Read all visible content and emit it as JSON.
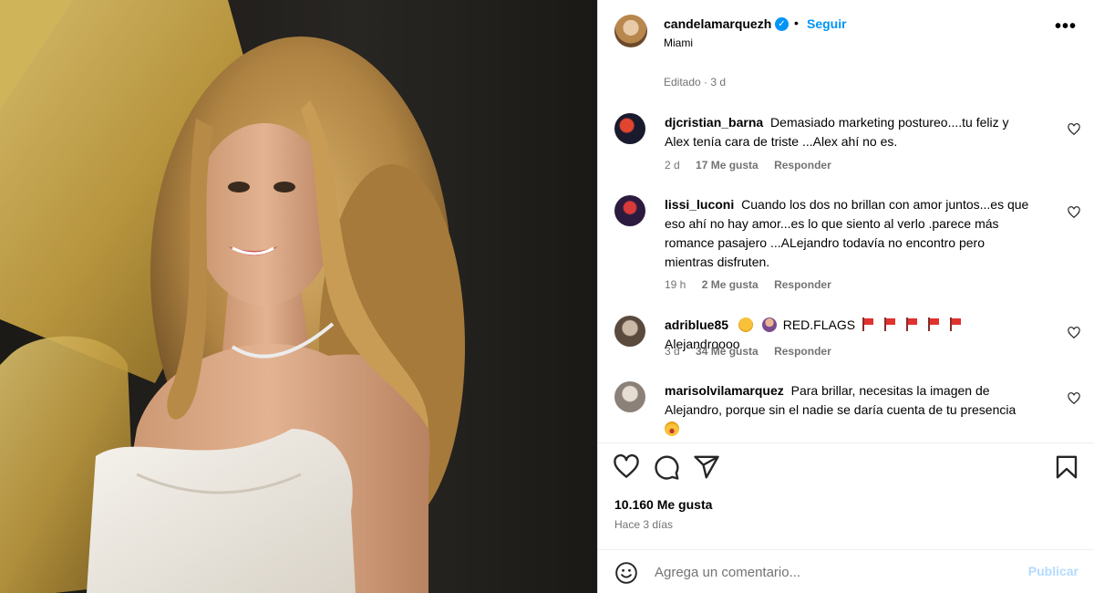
{
  "post": {
    "owner": "candelamarquezh",
    "verified_mark": "✓",
    "separator": "•",
    "follow_label": "Seguir",
    "location": "Miami",
    "more_label": "•••",
    "edited": "Editado · 3 d"
  },
  "comments": [
    {
      "user": "djcristian_barna",
      "text": "Demasiado marketing postureo....tu feliz y Alex tenía cara de triste ...Alex ahí no es.",
      "time": "2 d",
      "likes": "17 Me gusta",
      "reply": "Responder"
    },
    {
      "user": "lissi_luconi",
      "text": "Cuando los dos no brillan con amor juntos...es que eso ahí no hay amor...es lo que siento al verlo .parece más romance pasajero ...ALejandro todavía no encontro pero mientras disfruten.",
      "time": "19 h",
      "likes": "2 Me gusta",
      "reply": "Responder"
    },
    {
      "user": "adriblue85",
      "text_a": "RED.FLAGS",
      "text_b": "Alejandroooo",
      "time": "3 d",
      "likes": "34 Me gusta",
      "reply": "Responder"
    },
    {
      "user": "marisolvilamarquez",
      "text": "Para brillar, necesitas la imagen de Alejandro, porque sin el nadie se daría cuenta de tu presencia"
    }
  ],
  "actions": {
    "like_icon": "heart-icon",
    "comment_icon": "comment-icon",
    "share_icon": "paper-plane-icon",
    "save_icon": "bookmark-icon"
  },
  "stats": {
    "likes": "10.160 Me gusta",
    "posted_ago": "Hace 3 días"
  },
  "add_comment": {
    "placeholder": "Agrega un comentario...",
    "publish_label": "Publicar"
  },
  "colors": {
    "link_blue": "#0095f6",
    "muted_gray": "#737373",
    "publish_disabled": "#b3dbff"
  }
}
